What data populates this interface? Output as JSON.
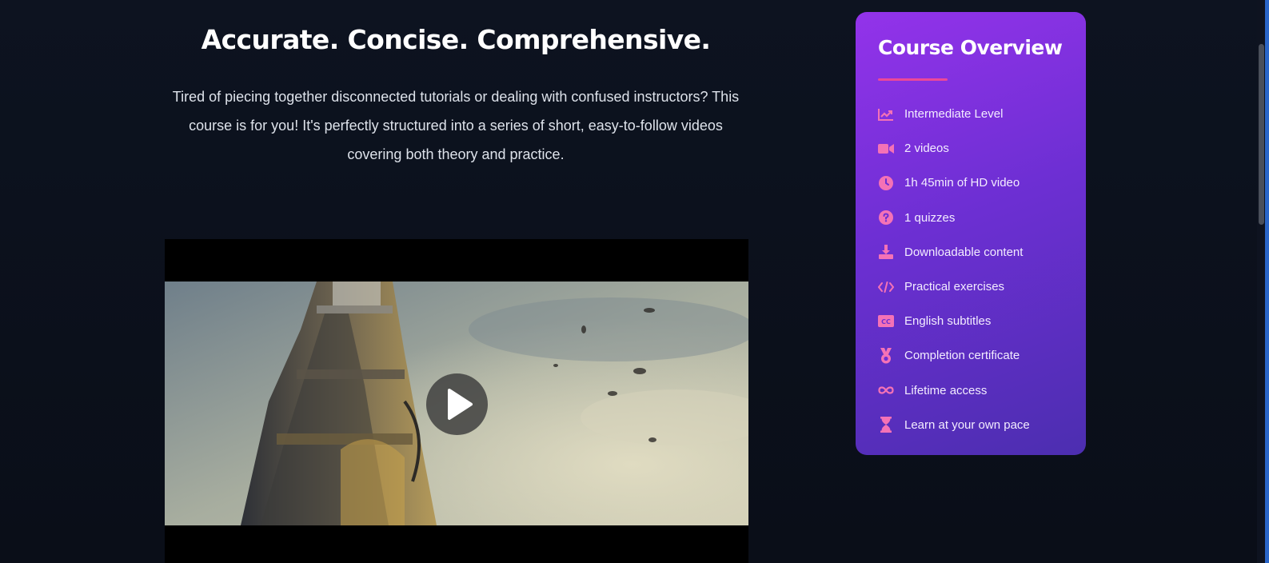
{
  "hero": {
    "title": "Accurate. Concise. Comprehensive.",
    "description": "Tired of piecing together disconnected tutorials or dealing with confused instructors? This course is for you! It's perfectly structured into a series of short, easy-to-follow videos covering both theory and practice."
  },
  "video": {
    "play_icon": "play-icon"
  },
  "overview": {
    "title": "Course Overview",
    "accent_color": "#ec4899",
    "items": [
      {
        "icon": "chart-line-icon",
        "label": "Intermediate Level"
      },
      {
        "icon": "video-camera-icon",
        "label": "2 videos"
      },
      {
        "icon": "clock-icon",
        "label": "1h 45min of HD video"
      },
      {
        "icon": "question-circle-icon",
        "label": "1 quizzes"
      },
      {
        "icon": "download-icon",
        "label": "Downloadable content"
      },
      {
        "icon": "code-icon",
        "label": "Practical exercises"
      },
      {
        "icon": "closed-captions-icon",
        "label": "English subtitles"
      },
      {
        "icon": "medal-icon",
        "label": "Completion certificate"
      },
      {
        "icon": "infinity-icon",
        "label": "Lifetime access"
      },
      {
        "icon": "hourglass-icon",
        "label": "Learn at your own pace"
      }
    ]
  }
}
